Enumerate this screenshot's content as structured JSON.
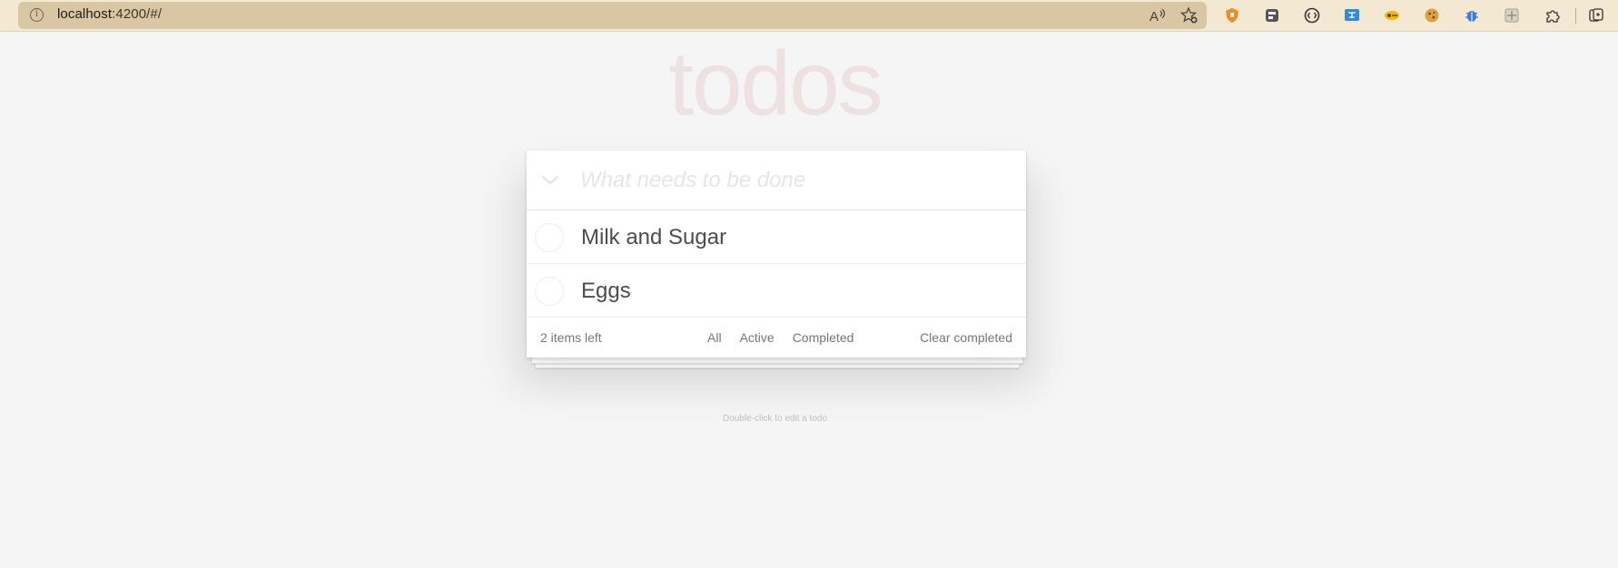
{
  "browser": {
    "url_host": "localhost",
    "url_rest": ":4200/#/",
    "icons": [
      "info-icon",
      "read-aloud-icon",
      "add-favorite-icon",
      "shield-extension-icon",
      "reader-extension-icon",
      "dev-tools-extension-icon",
      "translate-extension-icon",
      "key-extension-icon",
      "cookie-extension-icon",
      "bug-extension-icon",
      "grid-extension-icon",
      "extensions-puzzle-icon",
      "collections-icon"
    ],
    "colors": {
      "toolbar": "#f3e9d3",
      "address": "#d8c7a2"
    }
  },
  "app": {
    "title": "todos",
    "new_todo_placeholder": "What needs to be done",
    "new_todo_value": "",
    "todos": [
      {
        "label": "Milk and Sugar",
        "completed": false
      },
      {
        "label": "Eggs",
        "completed": false
      }
    ],
    "footer": {
      "count_text": "2 items left",
      "filters": [
        "All",
        "Active",
        "Completed"
      ],
      "clear_label": "Clear completed"
    },
    "info_text": "Double-click to edit a todo",
    "colors": {
      "title": "#af2f2f",
      "background": "#f5f5f5"
    }
  }
}
